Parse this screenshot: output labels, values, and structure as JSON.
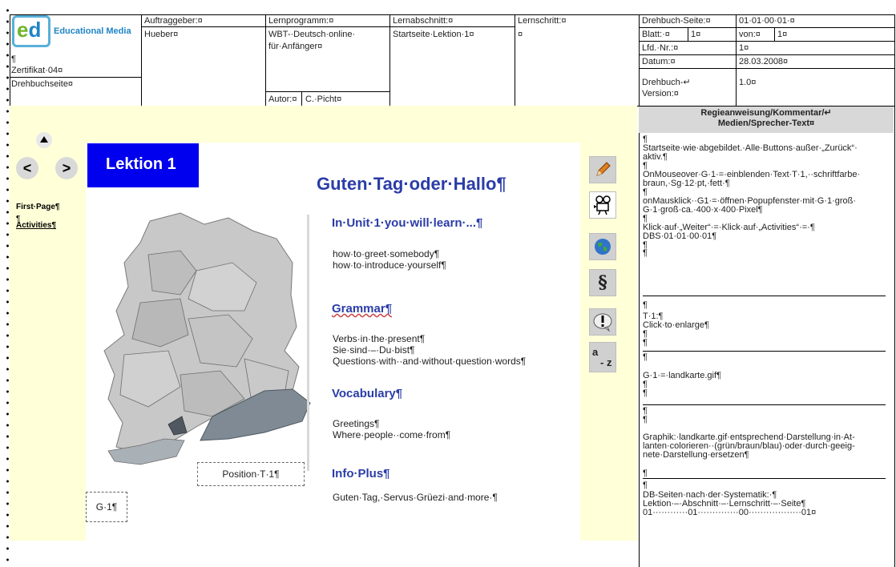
{
  "header": {
    "cert": "¶\nZertifikat·04¤",
    "drehbuchseite": "Drehbuchseite¤",
    "auftraggeber_label": "Auftraggeber:¤",
    "auftraggeber_value": "Hueber¤",
    "lernprogramm_label": "Lernprogramm:¤",
    "lernprogramm_value_1": "WBT-·Deutsch·online·",
    "lernprogramm_value_2": "für·Anfänger¤",
    "autor_label": "Autor:¤",
    "autor_value": "C.·Picht¤",
    "lernabschnitt_label": "Lernabschnitt:¤",
    "lernabschnitt_value": "Startseite·Lektion·1¤",
    "lernschritt_label": "Lernschritt:¤",
    "lernschritt_value": "¤",
    "drehbuch_seite_label": "Drehbuch-Seite:¤",
    "drehbuch_seite_value": "01·01·00·01·¤",
    "blatt_label": "Blatt:·¤",
    "blatt_value": "1¤",
    "von_label": "von:¤",
    "von_value": "1¤",
    "lfd_label": "Lfd.·Nr.:¤",
    "lfd_value": "1¤",
    "datum_label": "Datum:¤",
    "datum_value": "28.03.2008¤",
    "version_label_1": "Drehbuch-↵",
    "version_label_2": "Version:¤",
    "version_value": "1.0¤"
  },
  "logo": {
    "ed": "ed",
    "brand": "Educational Media"
  },
  "screen": {
    "lektion": "Lektion 1",
    "side_first": "First·Page¶",
    "side_pilcrow": "¶",
    "side_activities": "Activities¶",
    "title": "Guten·Tag·oder·Hallo¶",
    "unit_heading": "In·Unit·1·you·will·learn·...¶",
    "unit_lines": [
      "how·to·greet·somebody¶",
      "how·to·introduce·yourself¶"
    ],
    "grammar_heading": "Grammar¶",
    "grammar_lines": [
      "Verbs·in·the·present¶",
      "Sie·sind·–·Du·bist¶",
      "Questions·with··and·without·question·words¶"
    ],
    "vocab_heading": "Vocabulary¶",
    "vocab_lines": [
      "Greetings¶",
      "Where·people··come·from¶"
    ],
    "info_heading": "Info·Plus¶",
    "info_lines": [
      "Guten·Tag,·Servus·Grüezi·and·more·¶"
    ],
    "position_label": "Position·T·1¶",
    "g1_label": "G·1¶",
    "az_label_a": "a",
    "az_label_z": "- z"
  },
  "comment": {
    "heading_1": "Regieanweisung/Kommentar/↵",
    "heading_2": "Medien/Sprecher-Text¤",
    "lines": [
      "¶",
      "Startseite·wie·abgebildet.·Alle·Buttons·außer·„Zurück“·",
      "aktiv.¶",
      "¶",
      "OnMouseover·G·1·=·einblenden·Text·T·1,··schriftfarbe·",
      "braun,·Sg·12·pt,·fett·¶",
      "¶",
      "onMausklick··G1·=·öffnen·Popupfenster·mit·G·1·groß·",
      "G·1·groß·ca.·400·x·400·Pixel¶",
      "¶",
      "Klick·auf·„Weiter“·=·Klick·auf·„Activities“·=·¶",
      "DBS·01·01·00·01¶",
      "¶",
      "¶",
      "¶",
      "T·1:¶",
      "Click·to·enlarge¶",
      "¶",
      "¶",
      "¶",
      "G·1·=·landkarte.gif¶",
      "¶",
      "¶",
      "¶",
      "¶",
      "Graphik:·landkarte.gif·entsprechend·Darstellung·in·At-",
      "lanten·colorieren··(grün/braun/blau)·oder·durch·geeig-",
      "nete·Darstellung·ersetzen¶",
      "¶",
      "¶",
      "DB-Seiten·nach·der·Systematik:·¶",
      "Lektion·–·Abschnitt·–·Lernschritt·–·Seite¶",
      "01············01··············00··················01¤"
    ]
  },
  "colors": {
    "lektion_bg": "#0000ee",
    "heading": "#2b3da8",
    "yellow_bg": "#ffffd8"
  }
}
